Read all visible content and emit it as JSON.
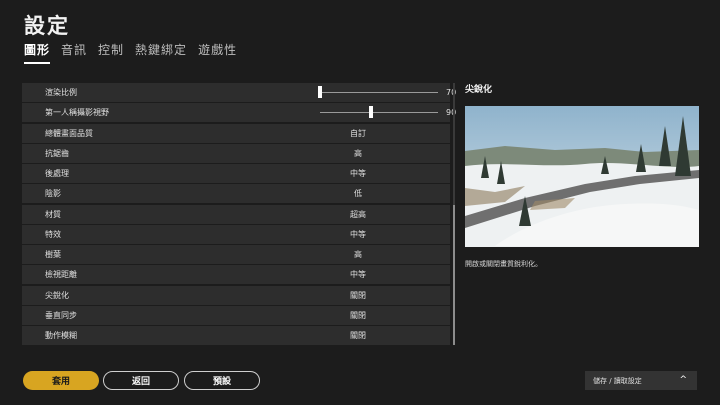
{
  "title": "設定",
  "tabs": [
    {
      "label": "圖形",
      "active": true
    },
    {
      "label": "音訊",
      "active": false
    },
    {
      "label": "控制",
      "active": false
    },
    {
      "label": "熱鍵綁定",
      "active": false
    },
    {
      "label": "遊戲性",
      "active": false
    }
  ],
  "settings": {
    "render_scale": {
      "label": "渲染比例",
      "value": "70",
      "level": 0.0
    },
    "fpp_fov": {
      "label": "第一人稱攝影視野",
      "value": "90",
      "level": 0.43
    },
    "rows": [
      {
        "label": "總體畫面品質",
        "value": "自訂"
      },
      {
        "label": "抗鋸齒",
        "value": "高"
      },
      {
        "label": "後處理",
        "value": "中等"
      },
      {
        "label": "陰影",
        "value": "低"
      },
      {
        "label": "材質",
        "value": "超高"
      },
      {
        "label": "特效",
        "value": "中等"
      },
      {
        "label": "樹葉",
        "value": "高"
      },
      {
        "label": "檢視距離",
        "value": "中等"
      },
      {
        "label": "尖銳化",
        "value": "關閉"
      },
      {
        "label": "垂直同步",
        "value": "關閉"
      },
      {
        "label": "動作模糊",
        "value": "關閉"
      }
    ]
  },
  "detail": {
    "title": "尖銳化",
    "description": "開啟或關閉畫質銳利化。"
  },
  "buttons": {
    "apply": "套用",
    "back": "返回",
    "preset": "預設"
  },
  "saveload": {
    "label": "儲存 / 讀取設定",
    "icon": "chevron-up-icon"
  },
  "colors": {
    "accent": "#d8a521",
    "row_bg": "#2d2d2d",
    "background": "#1c1c1c"
  }
}
